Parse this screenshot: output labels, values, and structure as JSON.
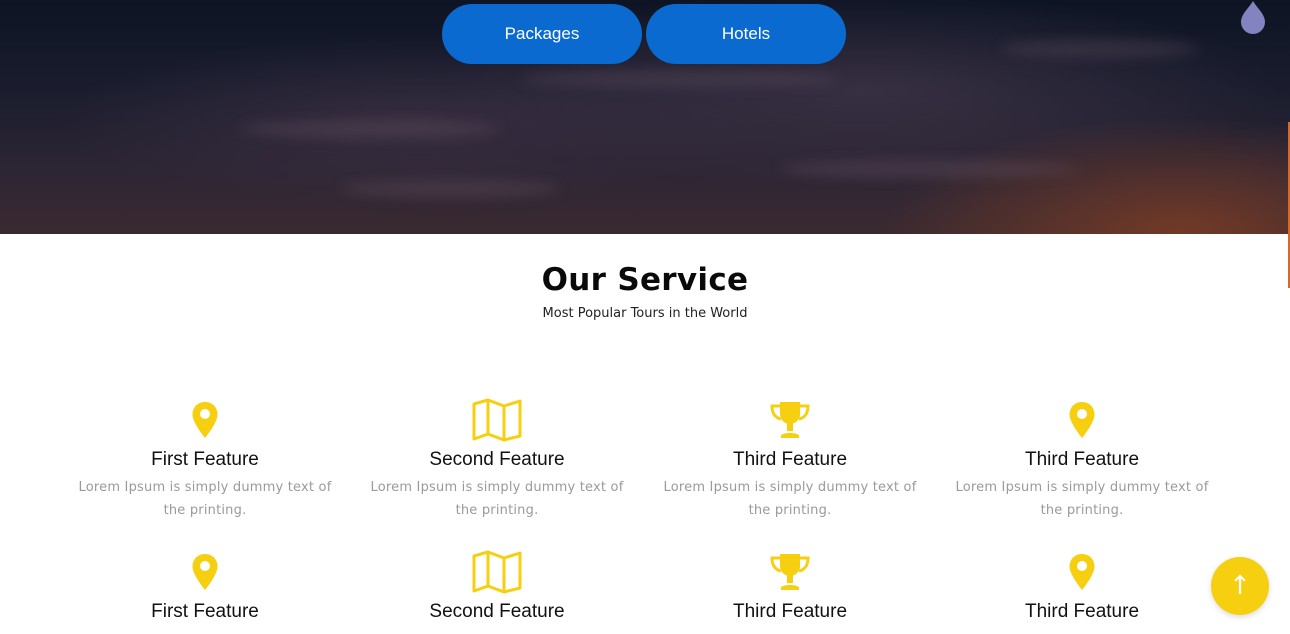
{
  "hero": {
    "buttons": [
      {
        "label": "Packages"
      },
      {
        "label": "Hotels"
      }
    ]
  },
  "service": {
    "title": "Our Service",
    "subtitle": "Most Popular Tours in the World"
  },
  "features": [
    {
      "icon": "map-pin-icon",
      "title": "First Feature",
      "desc": "Lorem Ipsum is simply dummy text of the printing."
    },
    {
      "icon": "map-icon",
      "title": "Second Feature",
      "desc": "Lorem Ipsum is simply dummy text of the printing."
    },
    {
      "icon": "trophy-icon",
      "title": "Third Feature",
      "desc": "Lorem Ipsum is simply dummy text of the printing."
    },
    {
      "icon": "map-pin-icon",
      "title": "Third Feature",
      "desc": "Lorem Ipsum is simply dummy text of the printing."
    },
    {
      "icon": "map-pin-icon",
      "title": "First Feature"
    },
    {
      "icon": "map-icon",
      "title": "Second Feature"
    },
    {
      "icon": "trophy-icon",
      "title": "Third Feature"
    },
    {
      "icon": "map-pin-icon",
      "title": "Third Feature"
    }
  ],
  "colors": {
    "accent": "#f6d010",
    "button": "#0a6ad0",
    "heading": "#0a0a0a",
    "muted_text": "#9a9a9a"
  },
  "scroll_top": {
    "icon": "arrow-up-icon",
    "symbol": "↑"
  }
}
